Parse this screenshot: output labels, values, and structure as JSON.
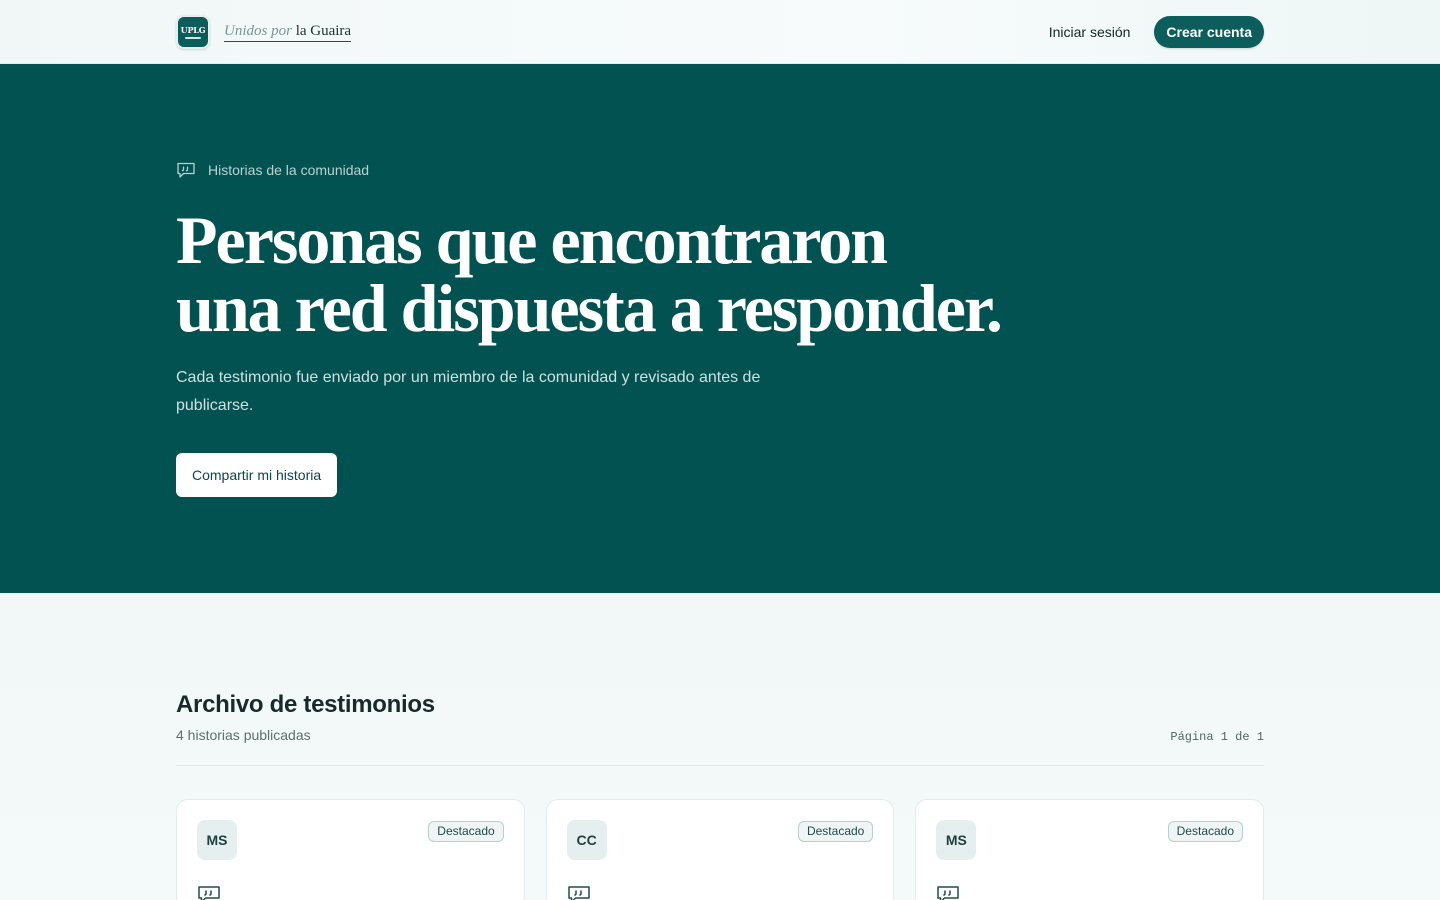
{
  "header": {
    "logo_text": "UPLG",
    "brand_light": "Unidos por",
    "brand_strong": "la Guaira",
    "login_label": "Iniciar sesión",
    "signup_label": "Crear cuenta"
  },
  "hero": {
    "eyebrow": "Historias de la comunidad",
    "title_line1": "Personas que encontraron",
    "title_line2": "una red dispuesta a responder.",
    "subtitle": "Cada testimonio fue enviado por un miembro de la comunidad y revisado antes de publicarse.",
    "cta_label": "Compartir mi historia"
  },
  "archive": {
    "title": "Archivo de testimonios",
    "count": "4 historias publicadas",
    "pager": "Página 1 de 1",
    "cards": [
      {
        "initials": "MS",
        "badge": "Destacado"
      },
      {
        "initials": "CC",
        "badge": "Destacado"
      },
      {
        "initials": "MS",
        "badge": "Destacado"
      }
    ]
  },
  "colors": {
    "brand": "#0c5e5c",
    "hero_bg": "#025252",
    "page_bg": "#f3f8f8"
  },
  "icons": {
    "eyebrow": "quote-bubble-icon",
    "card": "quote-bubble-icon"
  }
}
